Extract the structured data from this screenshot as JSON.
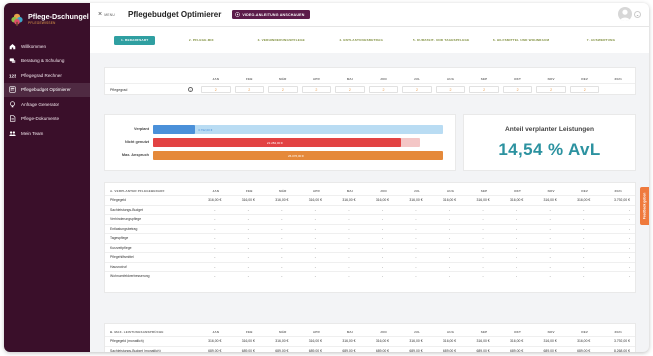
{
  "app": {
    "name": "Pflege-Dschungel",
    "tagline": "PFLEGEWISSEN"
  },
  "colors": {
    "sidebar": "#3a0f2a",
    "accent": "#5c1c4a",
    "teal": "#2f9fa1",
    "olive": "#7c8c3a",
    "blue": "#4a90d9",
    "red": "#e24243",
    "orange": "#e5893a",
    "kpi": "#2c92a0"
  },
  "sidebar": {
    "items": [
      {
        "label": "Willkommen",
        "icon": "home-icon"
      },
      {
        "label": "Beratung & Schulung",
        "icon": "consulting-icon"
      },
      {
        "label": "Pflegegrad Rechner",
        "icon": "calculator-icon"
      },
      {
        "label": "Pflegebudget Optimierer",
        "icon": "budget-icon",
        "active": true
      },
      {
        "label": "Anfrage Generator",
        "icon": "lightbulb-icon"
      },
      {
        "label": "Pflege-Dokumente",
        "icon": "document-icon"
      },
      {
        "label": "Mein Team",
        "icon": "team-icon"
      }
    ]
  },
  "header": {
    "menu_label": "MENU",
    "title": "Pflegebudget Optimierer",
    "video_button": "VIDEO-ANLEITUNG ANSCHAUEN"
  },
  "steps": [
    "1. BEDARFSART",
    "2. PFLEGE-MIX",
    "3. VERHINDERUNGSPFLEGE",
    "4. ENTLASTUNGSBETRAG",
    "5. KURZZEIT- UND TAGESPFLEGE",
    "6. HILFSMITTEL UND WOHNRAUM",
    "7. AUSWERTUNG"
  ],
  "months": [
    "JAN",
    "FEB",
    "MÄR",
    "APR",
    "MAI",
    "JUN",
    "JUL",
    "AUG",
    "SEP",
    "OKT",
    "NOV",
    "DEZ",
    "2021"
  ],
  "pflegegrad": {
    "label": "Pflegegrad",
    "values": [
      "2",
      "2",
      "2",
      "2",
      "2",
      "2",
      "2",
      "2",
      "2",
      "2",
      "2",
      "2"
    ]
  },
  "budget_chart": {
    "rows": [
      {
        "label": "Verplant",
        "value_text": "3.792,00 €",
        "value": 3792
      },
      {
        "label": "Nicht genutzt",
        "value_text": "22.284,00 €",
        "value": 22284
      },
      {
        "label": "Max. Anspruch",
        "value_text": "26.076,00 €",
        "value": 26076
      }
    ]
  },
  "kpi": {
    "title": "Anteil verplanter Leistungen",
    "value": "14,54 % AvL"
  },
  "table_a": {
    "title": "A. VERPLANTER PFLEGEBEDARF",
    "rows": [
      {
        "label": "Pflegegeld",
        "values": [
          "316,00 €",
          "316,00 €",
          "316,00 €",
          "316,00 €",
          "316,00 €",
          "316,00 €",
          "316,00 €",
          "316,00 €",
          "316,00 €",
          "316,00 €",
          "316,00 €",
          "316,00 €",
          "3.792,00 €"
        ]
      },
      {
        "label": "Sachleistungs-Budget",
        "values": [
          "-",
          "-",
          "-",
          "-",
          "-",
          "-",
          "-",
          "-",
          "-",
          "-",
          "-",
          "-",
          "-"
        ]
      },
      {
        "label": "Verhinderungspflege",
        "values": [
          "-",
          "-",
          "-",
          "-",
          "-",
          "-",
          "-",
          "-",
          "-",
          "-",
          "-",
          "-",
          "-"
        ]
      },
      {
        "label": "Entlastungsbetrag",
        "values": [
          "-",
          "-",
          "-",
          "-",
          "-",
          "-",
          "-",
          "-",
          "-",
          "-",
          "-",
          "-",
          "-"
        ]
      },
      {
        "label": "Tagespflege",
        "values": [
          "-",
          "-",
          "-",
          "-",
          "-",
          "-",
          "-",
          "-",
          "-",
          "-",
          "-",
          "-",
          "-"
        ]
      },
      {
        "label": "Kurzzeitpflege",
        "values": [
          "-",
          "-",
          "-",
          "-",
          "-",
          "-",
          "-",
          "-",
          "-",
          "-",
          "-",
          "-",
          "-"
        ]
      },
      {
        "label": "Pflegehilfsmittel",
        "values": [
          "-",
          "-",
          "-",
          "-",
          "-",
          "-",
          "-",
          "-",
          "-",
          "-",
          "-",
          "-",
          "-"
        ]
      },
      {
        "label": "Hausnotruf",
        "values": [
          "-",
          "-",
          "-",
          "-",
          "-",
          "-",
          "-",
          "-",
          "-",
          "-",
          "-",
          "-",
          "-"
        ]
      },
      {
        "label": "Wohnumfeldverbesserung",
        "values": [
          "-",
          "-",
          "-",
          "-",
          "-",
          "-",
          "-",
          "-",
          "-",
          "-",
          "-",
          "-",
          "-"
        ]
      }
    ]
  },
  "table_b": {
    "title": "B. MAX. LEISTUNGSANSPRÜCHE",
    "rows": [
      {
        "label": "Pflegegeld (monatlich)",
        "values": [
          "316,00 €",
          "316,00 €",
          "316,00 €",
          "316,00 €",
          "316,00 €",
          "316,00 €",
          "316,00 €",
          "316,00 €",
          "316,00 €",
          "316,00 €",
          "316,00 €",
          "316,00 €",
          "3.792,00 €"
        ]
      },
      {
        "label": "Sachleistungs-Budget (monatlich)",
        "values": [
          "689,00 €",
          "689,00 €",
          "689,00 €",
          "689,00 €",
          "689,00 €",
          "689,00 €",
          "689,00 €",
          "689,00 €",
          "689,00 €",
          "689,00 €",
          "689,00 €",
          "689,00 €",
          "8.268,00 €"
        ]
      }
    ]
  },
  "feedback": "Feedback geben"
}
